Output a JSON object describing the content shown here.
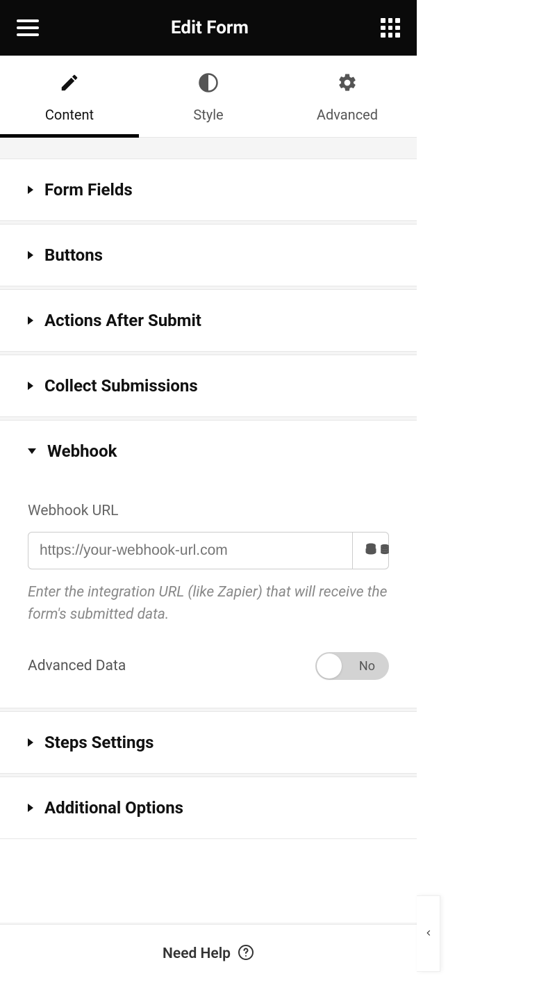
{
  "header": {
    "title": "Edit Form"
  },
  "tabs": [
    {
      "label": "Content",
      "active": true
    },
    {
      "label": "Style",
      "active": false
    },
    {
      "label": "Advanced",
      "active": false
    }
  ],
  "sections": {
    "form_fields": {
      "title": "Form Fields"
    },
    "buttons": {
      "title": "Buttons"
    },
    "actions_after_submit": {
      "title": "Actions After Submit"
    },
    "collect_submissions": {
      "title": "Collect Submissions"
    },
    "webhook": {
      "title": "Webhook",
      "url_label": "Webhook URL",
      "url_placeholder": "https://your-webhook-url.com",
      "url_value": "",
      "url_desc": "Enter the integration URL (like Zapier) that will receive the form's submitted data.",
      "advanced_data_label": "Advanced Data",
      "advanced_data_toggle": "No"
    },
    "steps_settings": {
      "title": "Steps Settings"
    },
    "additional_options": {
      "title": "Additional Options"
    }
  },
  "footer": {
    "help_text": "Need Help"
  }
}
